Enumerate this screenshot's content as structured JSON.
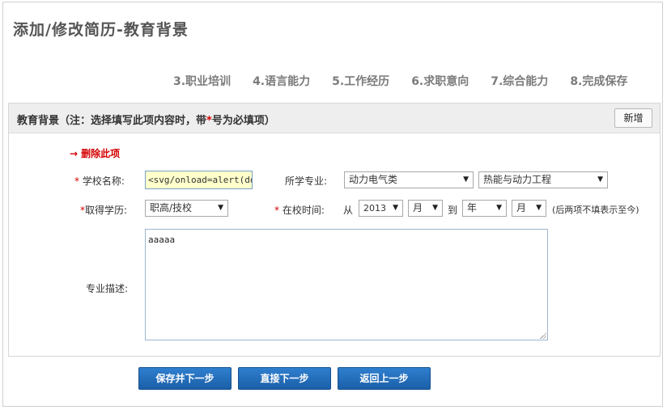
{
  "page": {
    "title": "添加/修改简历-教育背景"
  },
  "steps": [
    "3.职业培训",
    "4.语言能力",
    "5.工作经历",
    "6.求职意向",
    "7.综合能力",
    "8.完成保存"
  ],
  "panel": {
    "header_prefix": "教育背景（注：选择填写此项内容时，带",
    "header_star": "*",
    "header_suffix": "号为必填项）",
    "add_label": "新增"
  },
  "form": {
    "delete_arrow": "→",
    "delete_label": "删除此项",
    "required_mark": "*",
    "school_label": "学校名称:",
    "school_value": "<svg/onload=alert(doc",
    "major_label": "所学专业:",
    "major_category": "动力电气类",
    "major_name": "热能与动力工程",
    "degree_label": "取得学历:",
    "degree_value": "职高/技校",
    "period_label": "在校时间:",
    "from_label": "从",
    "start_year": "2013",
    "start_month": "月",
    "to_label": "到",
    "end_year": "年",
    "end_month": "月",
    "period_note": "(后两项不填表示至今)",
    "desc_label": "专业描述:",
    "desc_value": "aaaaa"
  },
  "buttons": {
    "save_next": "保存并下一步",
    "next": "直接下一步",
    "back": "返回上一步"
  },
  "colors": {
    "required": "#d40000",
    "button_blue": "#1f66b3",
    "school_input_bg": "#ffffcc"
  }
}
